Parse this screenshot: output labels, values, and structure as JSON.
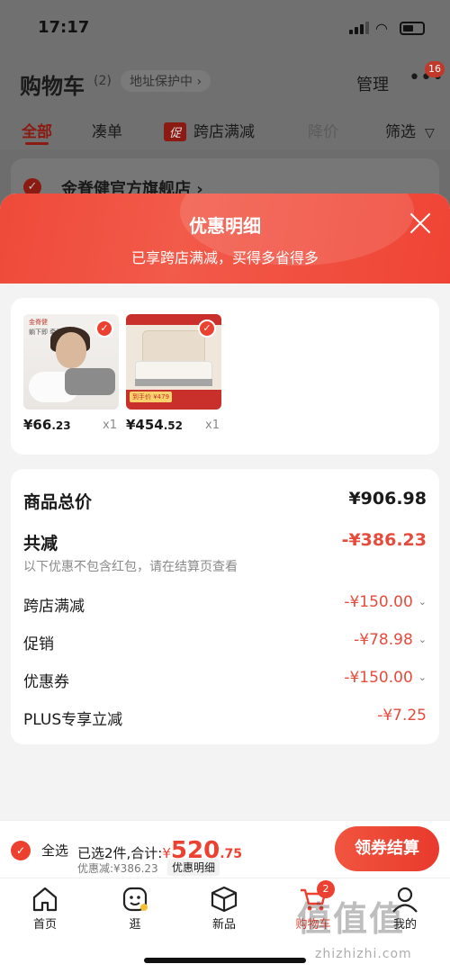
{
  "status": {
    "time": "17:17"
  },
  "header": {
    "title": "购物车",
    "count": "(2)",
    "address": "地址保护中",
    "manage": "管理",
    "message_badge": "16"
  },
  "filters": {
    "all": "全部",
    "combine": "凑单",
    "promo_tag": "促",
    "cross_store": "跨店满减",
    "price_drop": "降价",
    "filter": "筛选"
  },
  "shop": {
    "name": "金脊健官方旗舰店"
  },
  "sheet": {
    "title": "优惠明细",
    "subtitle": "已享跨店满减，买得多省得多"
  },
  "products": [
    {
      "price_int": "¥66",
      "price_dec": ".23",
      "qty": "x1",
      "brand": "金脊健",
      "tagline": "躺下即 牵引拉伸"
    },
    {
      "price_int": "¥454",
      "price_dec": ".52",
      "qty": "x1",
      "badge": "到手价 ¥479"
    }
  ],
  "details": {
    "total_label": "商品总价",
    "total_value": "¥906.98",
    "reduce_label": "共减",
    "reduce_value": "-¥386.23",
    "note": "以下优惠不包含红包，请在结算页查看",
    "items": [
      {
        "label": "跨店满减",
        "value": "-¥150.00"
      },
      {
        "label": "促销",
        "value": "-¥78.98"
      },
      {
        "label": "优惠券",
        "value": "-¥150.00"
      },
      {
        "label": "PLUS专享立减",
        "value": "-¥7.25"
      }
    ]
  },
  "checkout": {
    "select_all": "全选",
    "selected_text": "已选2件,合计:",
    "yen": "¥",
    "amount_int": "520",
    "amount_dec": ".75",
    "saved": "优惠减:¥386.23",
    "detail_link": "优惠明细",
    "button": "领券结算"
  },
  "tabbar": {
    "items": [
      {
        "label": "首页",
        "icon": "home-icon"
      },
      {
        "label": "逛",
        "icon": "browse-icon"
      },
      {
        "label": "新品",
        "icon": "box-icon"
      },
      {
        "label": "购物车",
        "icon": "cart-icon",
        "badge": "2"
      },
      {
        "label": "我的",
        "icon": "user-icon"
      }
    ]
  },
  "watermark": {
    "main": "值值值",
    "sub": "zhizhizhi.com"
  },
  "colors": {
    "accent": "#ec4131",
    "sheet_bg": "#f3f3f3",
    "overlay": "#707070"
  }
}
